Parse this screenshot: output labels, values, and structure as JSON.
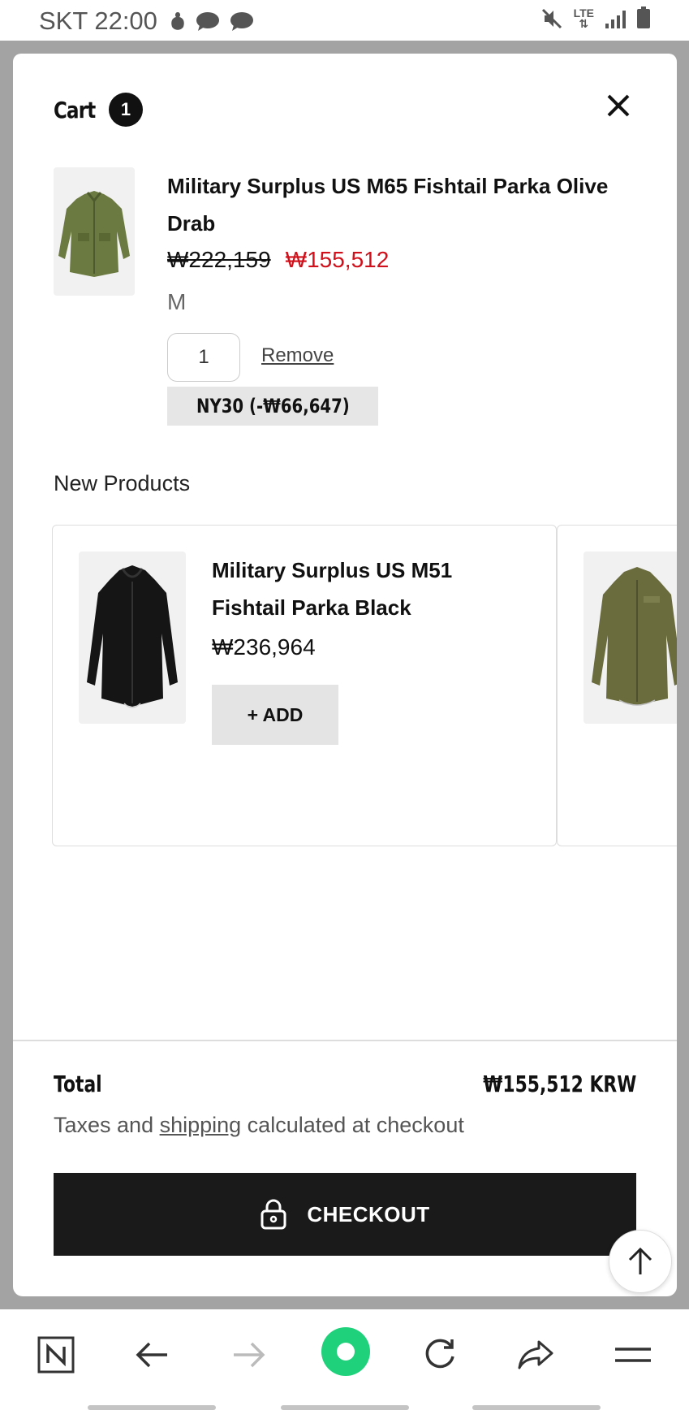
{
  "status_bar": {
    "carrier_time": "SKT 22:00",
    "network": "LTE"
  },
  "cart": {
    "title": "Cart",
    "count": "1",
    "item": {
      "name": "Military Surplus US M65 Fishtail Parka Olive Drab",
      "original_price": "₩222,159",
      "sale_price": "₩155,512",
      "variant": "M",
      "quantity": "1",
      "remove_label": "Remove",
      "discount": "NY30 (-₩66,647)"
    }
  },
  "new_products": {
    "title": "New Products",
    "items": [
      {
        "name": "Military Surplus US M51 Fishtail Parka Black",
        "price": "₩236,964",
        "add_label": "+ ADD",
        "color": "#151515"
      },
      {
        "color": "#6b6c3e"
      }
    ]
  },
  "footer": {
    "total_label": "Total",
    "total_value": "₩155,512 KRW",
    "tax_prefix": "Taxes and ",
    "tax_link": "shipping",
    "tax_suffix": " calculated at checkout",
    "checkout_label": "CHECKOUT"
  },
  "colors": {
    "sale_red": "#d0111b",
    "checkout_bg": "#1a1a1a",
    "browser_accent": "#1fd17a",
    "olive": "#6b7a40"
  },
  "browser_nav": {
    "icons": [
      "naver-icon",
      "back-icon",
      "forward-icon",
      "home-icon",
      "refresh-icon",
      "share-icon",
      "menu-icon"
    ]
  }
}
